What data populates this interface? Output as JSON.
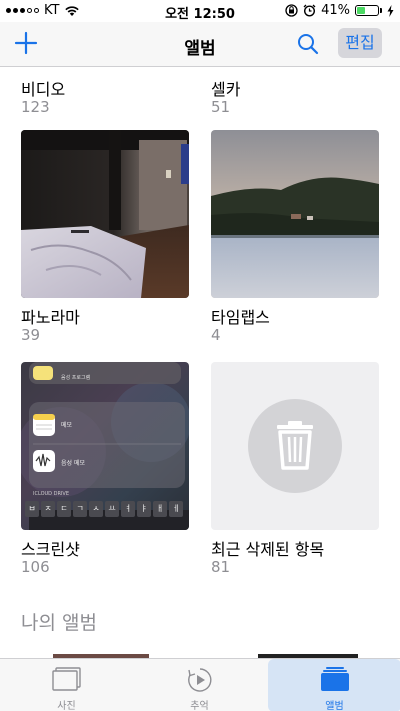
{
  "status_bar": {
    "carrier": "KT",
    "time": "오전 12:50",
    "battery_percent": "41%",
    "battery_level": 0.41,
    "icons": [
      "signal-dots",
      "wifi-icon",
      "orientation-lock-icon",
      "alarm-icon",
      "charging-icon"
    ]
  },
  "nav": {
    "title": "앨범",
    "edit_label": "편집",
    "add_icon": "plus-icon",
    "search_icon": "search-icon"
  },
  "albums": [
    {
      "name": "비디오",
      "count": "123"
    },
    {
      "name": "셀카",
      "count": "51"
    },
    {
      "name": "파노라마",
      "count": "39"
    },
    {
      "name": "타임랩스",
      "count": "4"
    },
    {
      "name": "스크린샷",
      "count": "106"
    },
    {
      "name": "최근 삭제된 항목",
      "count": "81"
    }
  ],
  "screenshot_thumb": {
    "memo_label_1": "메모",
    "memo_label_2": "음성 메모",
    "icloud_label": "ICLOUD DRIVE",
    "top_text": "음성 프로그램",
    "keys": [
      "ㅂ",
      "ㅈ",
      "ㄷ",
      "ㄱ",
      "ㅅ",
      "ㅛ",
      "ㅕ",
      "ㅑ",
      "ㅐ",
      "ㅔ"
    ]
  },
  "my_albums": {
    "section_title": "나의 앨범"
  },
  "tabs": [
    {
      "label": "사진",
      "icon": "photos-icon"
    },
    {
      "label": "추억",
      "icon": "memories-icon"
    },
    {
      "label": "앨범",
      "icon": "albums-icon"
    }
  ],
  "colors": {
    "accent": "#1a73e8",
    "secondary_text": "#8e8e93",
    "trash_bg": "#efeff1",
    "trash_circle": "#d3d3d6"
  }
}
